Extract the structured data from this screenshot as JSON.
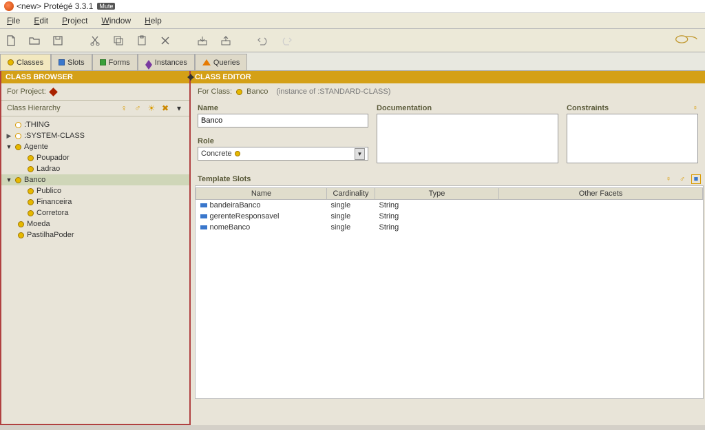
{
  "titlebar": {
    "text": "<new>  Protégé 3.3.1",
    "mute": "Mute"
  },
  "menu": {
    "file": "File",
    "edit": "Edit",
    "project": "Project",
    "window": "Window",
    "help": "Help"
  },
  "tabs": {
    "classes": "Classes",
    "slots": "Slots",
    "forms": "Forms",
    "instances": "Instances",
    "queries": "Queries"
  },
  "classBrowser": {
    "title": "CLASS BROWSER",
    "forProject": "For Project:",
    "hierLabel": "Class Hierarchy",
    "tree": {
      "thing": ":THING",
      "system": ":SYSTEM-CLASS",
      "agente": "Agente",
      "poupador": "Poupador",
      "ladrao": "Ladrao",
      "banco": "Banco",
      "publico": "Publico",
      "financeira": "Financeira",
      "corretora": "Corretora",
      "moeda": "Moeda",
      "pastilha": "PastilhaPoder"
    }
  },
  "classEditor": {
    "title": "CLASS EDITOR",
    "forClassLabel": "For Class:",
    "forClassName": "Banco",
    "instanceOf": "(instance of :STANDARD-CLASS)",
    "form": {
      "nameLabel": "Name",
      "nameValue": "Banco",
      "docLabel": "Documentation",
      "constraintsLabel": "Constraints",
      "roleLabel": "Role",
      "roleValue": "Concrete"
    },
    "slots": {
      "label": "Template Slots",
      "headers": {
        "name": "Name",
        "cardinality": "Cardinality",
        "type": "Type",
        "facets": "Other Facets"
      },
      "rows": [
        {
          "name": "bandeiraBanco",
          "cardinality": "single",
          "type": "String",
          "facets": ""
        },
        {
          "name": "gerenteResponsavel",
          "cardinality": "single",
          "type": "String",
          "facets": ""
        },
        {
          "name": "nomeBanco",
          "cardinality": "single",
          "type": "String",
          "facets": ""
        }
      ]
    }
  }
}
